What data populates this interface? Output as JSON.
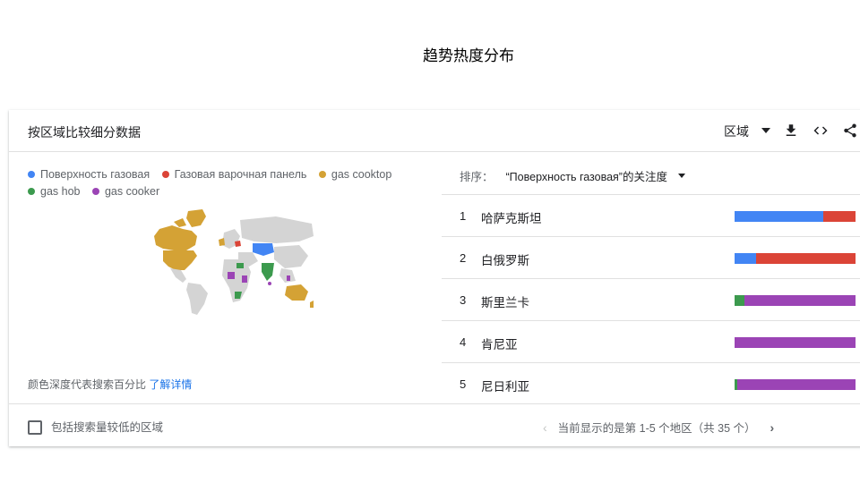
{
  "page": {
    "title": "趋势热度分布"
  },
  "card": {
    "title": "按区域比较细分数据",
    "region_select": "区域",
    "icons": [
      "download-icon",
      "embed-code-icon",
      "share-icon"
    ]
  },
  "legend": [
    {
      "label": "Поверхность газовая",
      "color": "#4285f4"
    },
    {
      "label": "Газовая варочная панель",
      "color": "#db4437"
    },
    {
      "label": "gas cooktop",
      "color": "#d4a235"
    },
    {
      "label": "gas hob",
      "color": "#3c9a4e"
    },
    {
      "label": "gas cooker",
      "color": "#9b44b5"
    }
  ],
  "map": {
    "note": "颜色深度代表搜索百分比",
    "note_link": "了解详情"
  },
  "sort": {
    "label": "排序：",
    "value": "“Поверхность газовая”的关注度"
  },
  "regions": [
    {
      "rank": "1",
      "name": "哈萨克斯坦",
      "shares": [
        {
          "color": "#4285f4",
          "pct": 73
        },
        {
          "color": "#db4437",
          "pct": 27
        }
      ]
    },
    {
      "rank": "2",
      "name": "白俄罗斯",
      "shares": [
        {
          "color": "#4285f4",
          "pct": 18
        },
        {
          "color": "#db4437",
          "pct": 82
        }
      ]
    },
    {
      "rank": "3",
      "name": "斯里兰卡",
      "shares": [
        {
          "color": "#3c9a4e",
          "pct": 8
        },
        {
          "color": "#9b44b5",
          "pct": 92
        }
      ]
    },
    {
      "rank": "4",
      "name": "肯尼亚",
      "shares": [
        {
          "color": "#9b44b5",
          "pct": 100
        }
      ]
    },
    {
      "rank": "5",
      "name": "尼日利亚",
      "shares": [
        {
          "color": "#3c9a4e",
          "pct": 2
        },
        {
          "color": "#9b44b5",
          "pct": 98
        }
      ]
    }
  ],
  "footer": {
    "checkbox_label": "包括搜索量较低的区域",
    "checked": false,
    "pagination": "当前显示的是第 1-5 个地区（共 35 个）"
  }
}
